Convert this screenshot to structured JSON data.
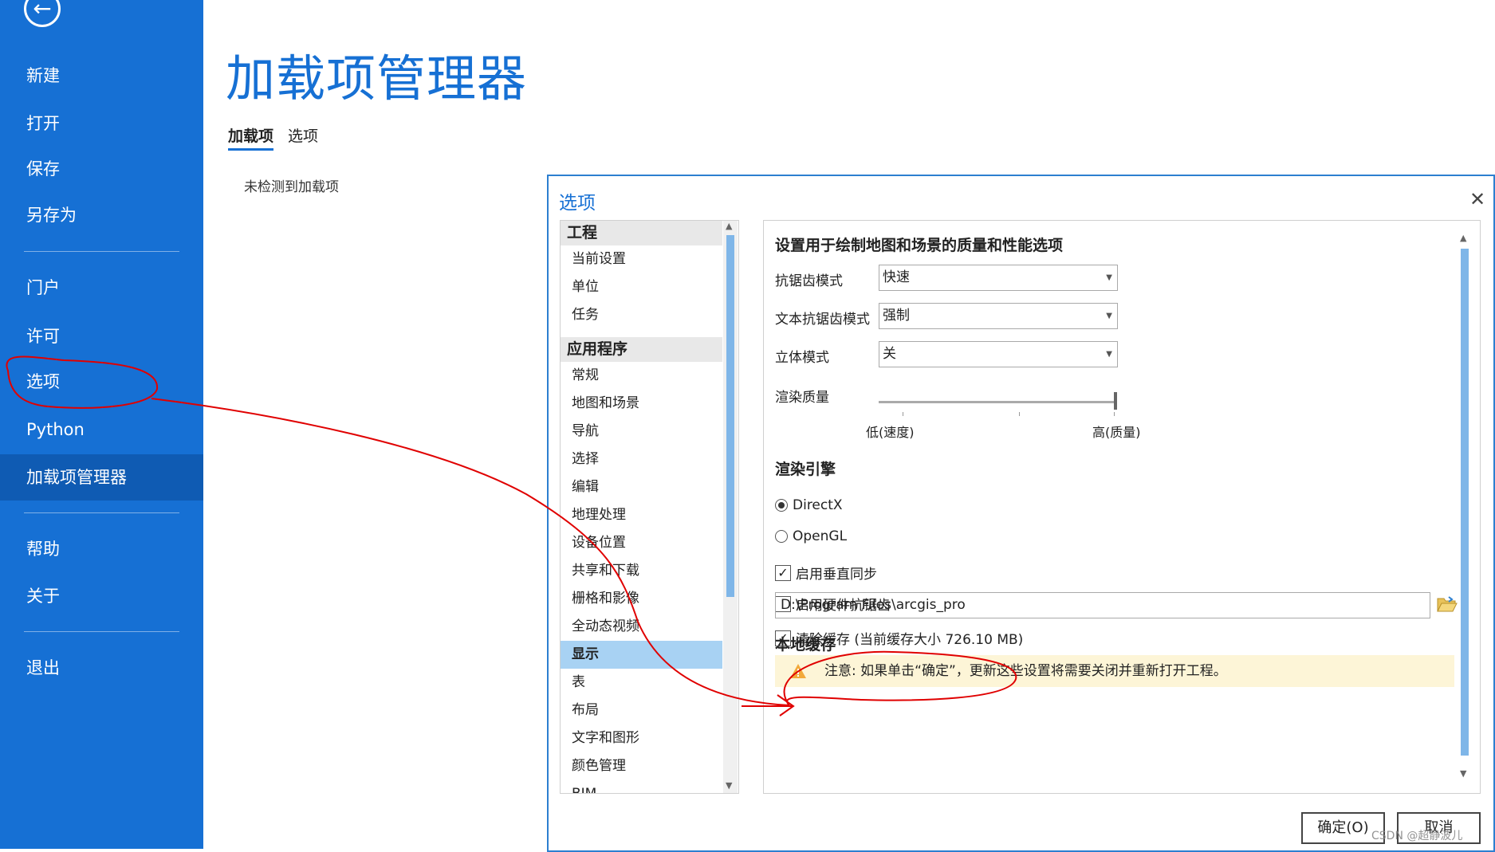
{
  "sidebar": {
    "back_icon": "back-arrow-icon",
    "items": [
      {
        "label": "新建"
      },
      {
        "label": "打开"
      },
      {
        "label": "保存"
      },
      {
        "label": "另存为"
      },
      {
        "label": "门户"
      },
      {
        "label": "许可"
      },
      {
        "label": "选项"
      },
      {
        "label": "Python"
      },
      {
        "label": "加载项管理器"
      },
      {
        "label": "帮助"
      },
      {
        "label": "关于"
      },
      {
        "label": "退出"
      }
    ],
    "active_item": "加载项管理器"
  },
  "page": {
    "title": "加载项管理器",
    "tabs": [
      "加载项",
      "选项"
    ],
    "selected_tab": "加载项",
    "empty_message": "未检测到加载项"
  },
  "dialog": {
    "title": "选项",
    "close_icon": "close-icon",
    "nav": {
      "groups": [
        {
          "label": "工程",
          "items": [
            "当前设置",
            "单位",
            "任务"
          ]
        },
        {
          "label": "应用程序",
          "items": [
            "常规",
            "地图和场景",
            "导航",
            "选择",
            "编辑",
            "地理处理",
            "设备位置",
            "共享和下载",
            "栅格和影像",
            "全动态视频",
            "显示",
            "表",
            "布局",
            "文字和图形",
            "颜色管理",
            "BIM"
          ]
        }
      ],
      "selected": "显示"
    },
    "pane": {
      "heading": "设置用于绘制地图和场景的质量和性能选项",
      "antialias_label": "抗锯齿模式",
      "antialias_value": "快速",
      "text_antialias_label": "文本抗锯齿模式",
      "text_antialias_value": "强制",
      "stereo_label": "立体模式",
      "stereo_value": "关",
      "render_quality_label": "渲染质量",
      "render_quality_level": 1.0,
      "slider_low": "低(速度)",
      "slider_high": "高(质量)",
      "engine_heading": "渲染引擎",
      "engine_options": [
        "DirectX",
        "OpenGL"
      ],
      "engine_selected": "DirectX",
      "vsync_label": "启用垂直同步",
      "vsync_checked": true,
      "hw_aa_label": "启用硬件抗锯齿",
      "hw_aa_checked": false,
      "cache_heading": "本地缓存",
      "cache_path": "D:\\Program Files\\arcgis_pro",
      "clear_cache_label": "清除缓存 (当前缓存大小 726.10 MB)",
      "clear_cache_checked": true,
      "warning_text": "注意: 如果单击“确定”，更新这些设置将需要关闭并重新打开工程。",
      "warning_icon": "warning-icon",
      "folder_icon": "folder-open-icon"
    },
    "ok_label": "确定(O)",
    "cancel_label": "取消"
  },
  "watermark": "CSDN @超静波儿",
  "colors": {
    "sidebar": "#1670d4",
    "sidebar_active": "#0f5bb3",
    "accent": "#1670d4",
    "nav_selected": "#a8d2f3",
    "warning_bg": "#fdf5d7",
    "annotation": "#e00000"
  }
}
